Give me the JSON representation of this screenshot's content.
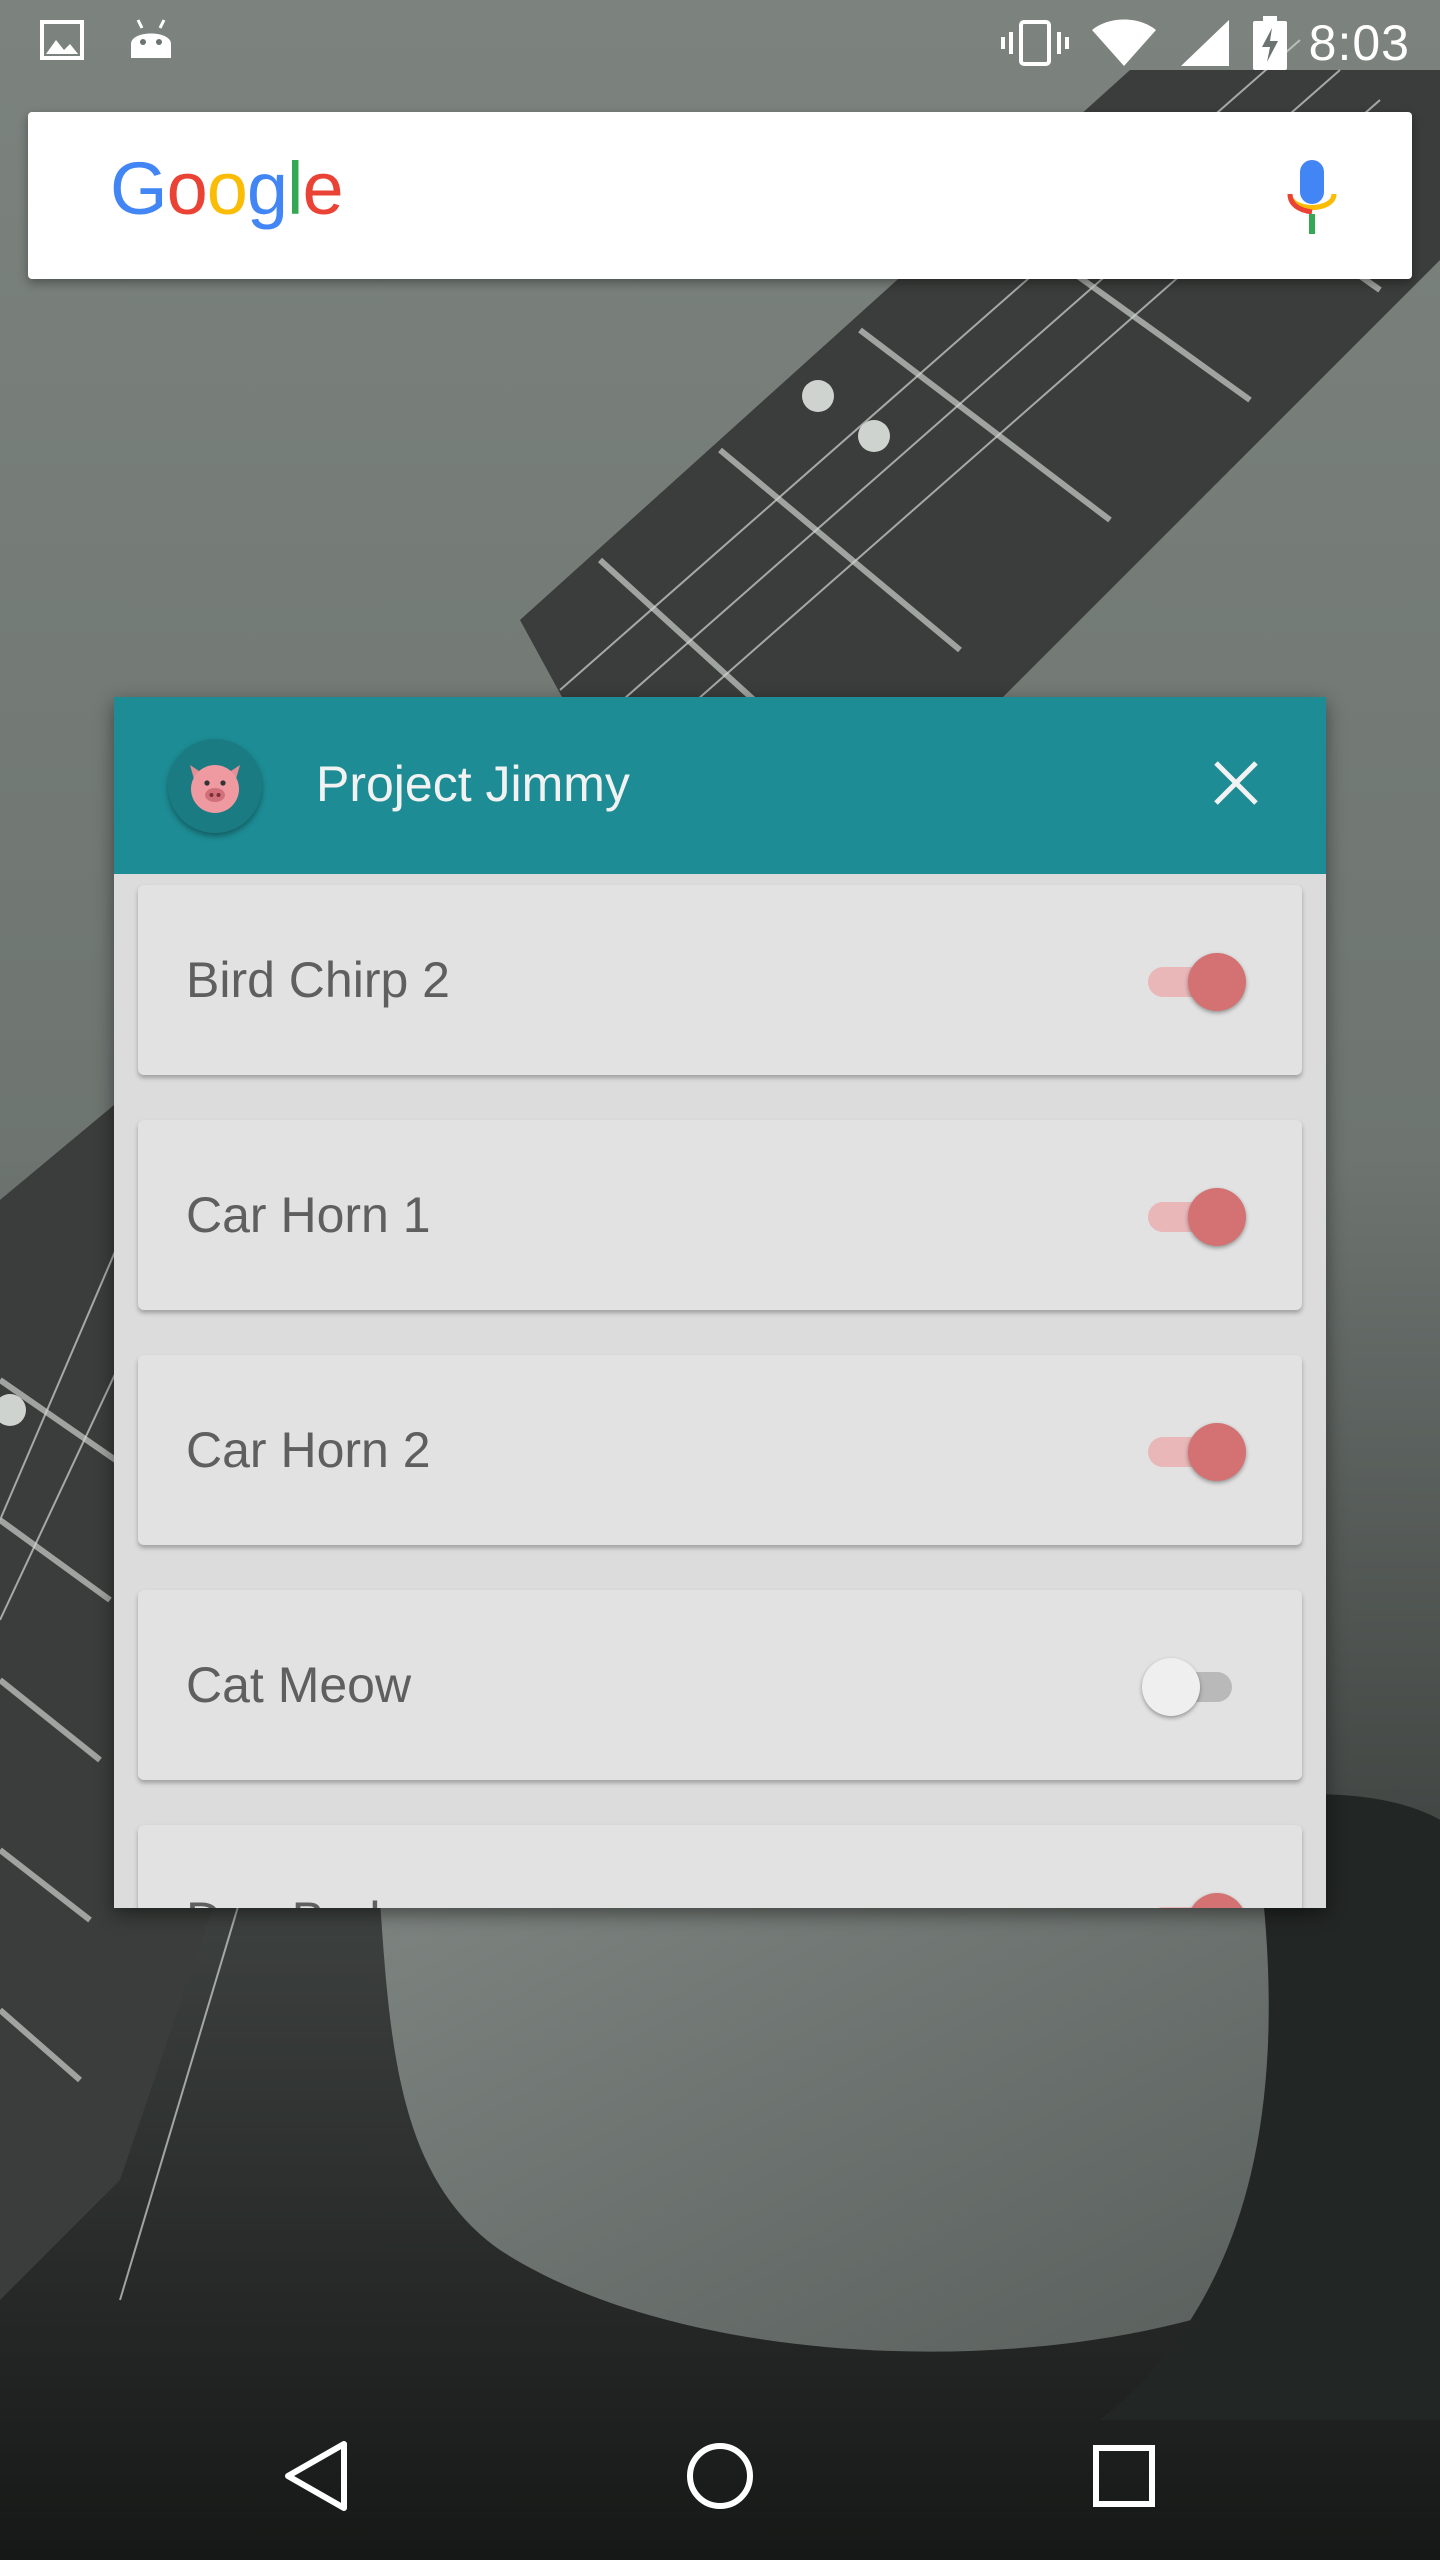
{
  "status_bar": {
    "time": "8:03",
    "left_icons": [
      "image-icon",
      "android-icon"
    ],
    "right_icons": [
      "vibrate-icon",
      "wifi-icon",
      "cell-signal-icon",
      "battery-charging-icon"
    ]
  },
  "search": {
    "logo_letters": [
      "G",
      "o",
      "o",
      "g",
      "l",
      "e"
    ],
    "logo_colors": [
      "#4285F4",
      "#EA4335",
      "#FBBC05",
      "#4285F4",
      "#34A853",
      "#EA4335"
    ],
    "mic_icon": "mic-icon"
  },
  "widget": {
    "title": "Project Jimmy",
    "header_color": "#1d8c94",
    "avatar_icon": "pig-icon",
    "close_icon": "close-icon",
    "items": [
      {
        "label": "Bird Chirp 2",
        "enabled": true
      },
      {
        "label": "Car Horn 1",
        "enabled": true
      },
      {
        "label": "Car Horn 2",
        "enabled": true
      },
      {
        "label": "Cat Meow",
        "enabled": false
      },
      {
        "label": "Dog Bark",
        "enabled": true
      }
    ],
    "switch_on_color": "#d47172"
  },
  "nav_bar": {
    "buttons": [
      "back-icon",
      "home-icon",
      "recents-icon"
    ]
  }
}
